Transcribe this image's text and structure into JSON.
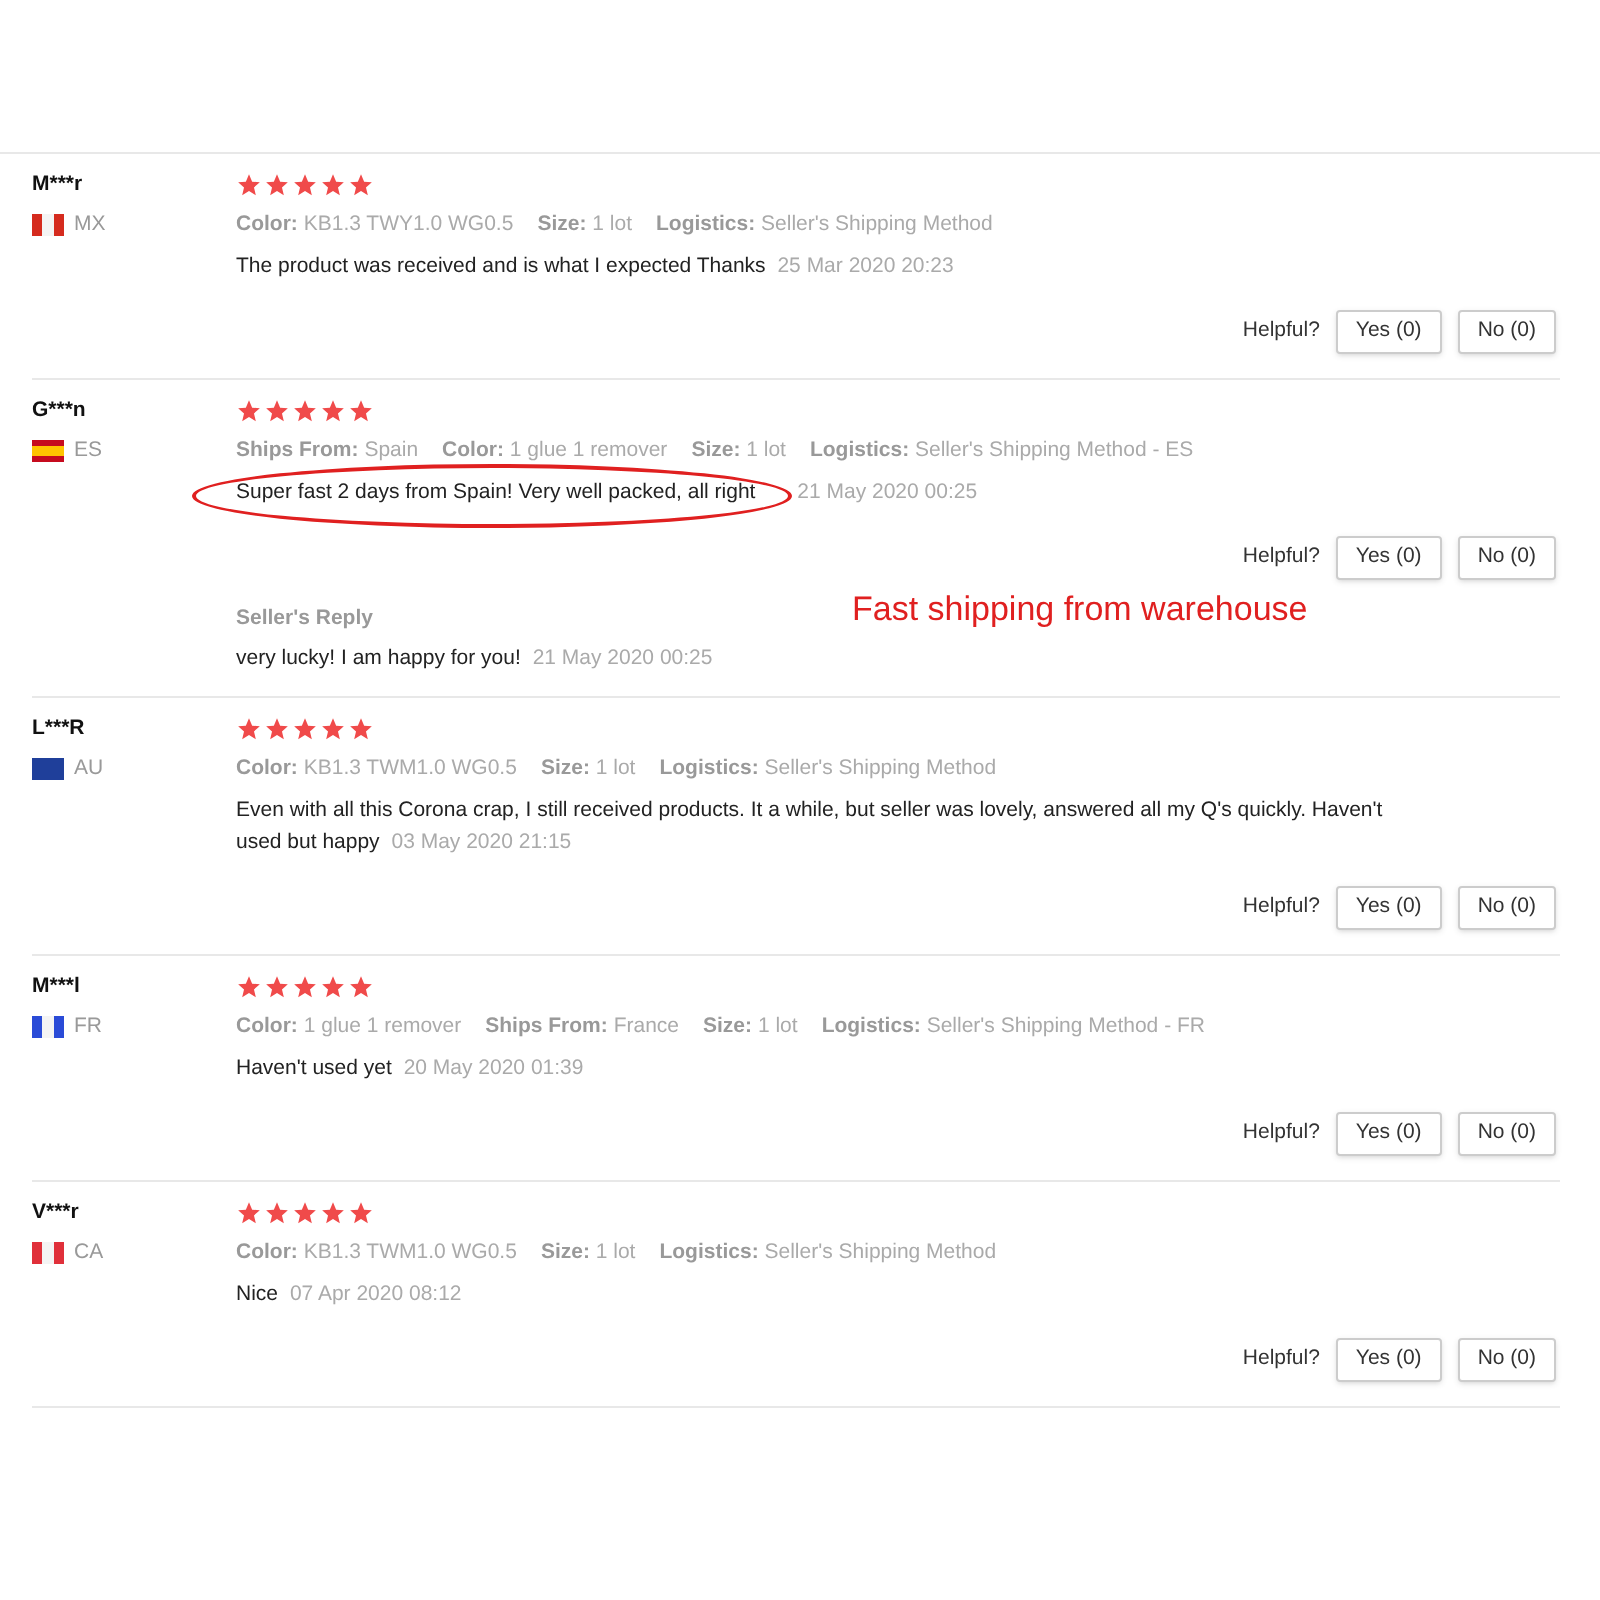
{
  "reviews": [
    {
      "name": "M***r",
      "country": "MX",
      "flag": {
        "kind": "vertical",
        "color": "#d52b1e"
      },
      "stars": 5,
      "meta": [
        {
          "label": "Color:",
          "value": "KB1.3 TWY1.0 WG0.5"
        },
        {
          "label": "Size:",
          "value": "1 lot"
        },
        {
          "label": "Logistics:",
          "value": "Seller's Shipping Method"
        }
      ],
      "text": "The product was received and is what I expected Thanks",
      "date": "25 Mar 2020 20:23",
      "helpful": "Helpful?",
      "yes": "Yes (0)",
      "no": "No (0)"
    },
    {
      "name": "G***n",
      "country": "ES",
      "flag": {
        "kind": "horizontal",
        "color": "#c60b1e"
      },
      "stars": 5,
      "meta": [
        {
          "label": "Ships From:",
          "value": "Spain"
        },
        {
          "label": "Color:",
          "value": "1 glue 1 remover"
        },
        {
          "label": "Size:",
          "value": "1 lot"
        },
        {
          "label": "Logistics:",
          "value": "Seller's Shipping Method - ES"
        }
      ],
      "text": "Super fast 2 days from Spain! Very well packed, all right",
      "date": "21 May 2020 00:25",
      "helpful": "Helpful?",
      "yes": "Yes (0)",
      "no": "No (0)",
      "annotation": "Fast shipping from warehouse",
      "reply": {
        "label": "Seller's Reply",
        "text": "very lucky! I am happy for you!",
        "date": "21 May 2020 00:25"
      }
    },
    {
      "name": "L***R",
      "country": "AU",
      "flag": {
        "kind": "solid",
        "color": "#1f3f9a"
      },
      "stars": 5,
      "meta": [
        {
          "label": "Color:",
          "value": "KB1.3 TWM1.0 WG0.5"
        },
        {
          "label": "Size:",
          "value": "1 lot"
        },
        {
          "label": "Logistics:",
          "value": "Seller's Shipping Method"
        }
      ],
      "text": "Even with all this Corona crap, I still received products. It a while, but seller was lovely, answered all my Q's quickly. Haven't used but happy",
      "date": "03 May 2020 21:15",
      "helpful": "Helpful?",
      "yes": "Yes (0)",
      "no": "No (0)"
    },
    {
      "name": "M***l",
      "country": "FR",
      "flag": {
        "kind": "vertical",
        "color": "#2a4bd7"
      },
      "stars": 5,
      "meta": [
        {
          "label": "Color:",
          "value": "1 glue 1 remover"
        },
        {
          "label": "Ships From:",
          "value": "France"
        },
        {
          "label": "Size:",
          "value": "1 lot"
        },
        {
          "label": "Logistics:",
          "value": "Seller's Shipping Method - FR"
        }
      ],
      "text": "Haven't used yet",
      "date": "20 May 2020 01:39",
      "helpful": "Helpful?",
      "yes": "Yes (0)",
      "no": "No (0)"
    },
    {
      "name": "V***r",
      "country": "CA",
      "flag": {
        "kind": "vertical",
        "color": "#e0303a"
      },
      "stars": 5,
      "meta": [
        {
          "label": "Color:",
          "value": "KB1.3 TWM1.0 WG0.5"
        },
        {
          "label": "Size:",
          "value": "1 lot"
        },
        {
          "label": "Logistics:",
          "value": "Seller's Shipping Method"
        }
      ],
      "text": "Nice",
      "date": "07 Apr 2020 08:12",
      "helpful": "Helpful?",
      "yes": "Yes (0)",
      "no": "No (0)"
    }
  ]
}
